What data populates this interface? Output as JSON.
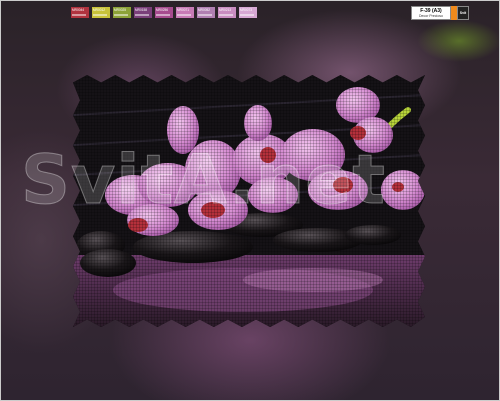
{
  "legend": {
    "swatches": [
      {
        "code": "MR0044",
        "color": "#b0333f"
      },
      {
        "code": "MR0012",
        "color": "#c8c23a"
      },
      {
        "code": "MR0025",
        "color": "#8ca238"
      },
      {
        "code": "MR0158",
        "color": "#7a3f7a"
      },
      {
        "code": "MR0256",
        "color": "#a64b8e"
      },
      {
        "code": "MR0071",
        "color": "#c77ab5"
      },
      {
        "code": "MR0052",
        "color": "#b07fb1"
      },
      {
        "code": "MR0213",
        "color": "#c98cc0"
      },
      {
        "code": "MR0073",
        "color": "#d7a8d4"
      }
    ]
  },
  "title_box": {
    "code": "F-39 (A3)",
    "subtitle": "Decor Precioso"
  },
  "logo": {
    "text": "Svit"
  },
  "watermark": "SvitA.net",
  "icons": {
    "logo": "brand-logo-icon"
  }
}
